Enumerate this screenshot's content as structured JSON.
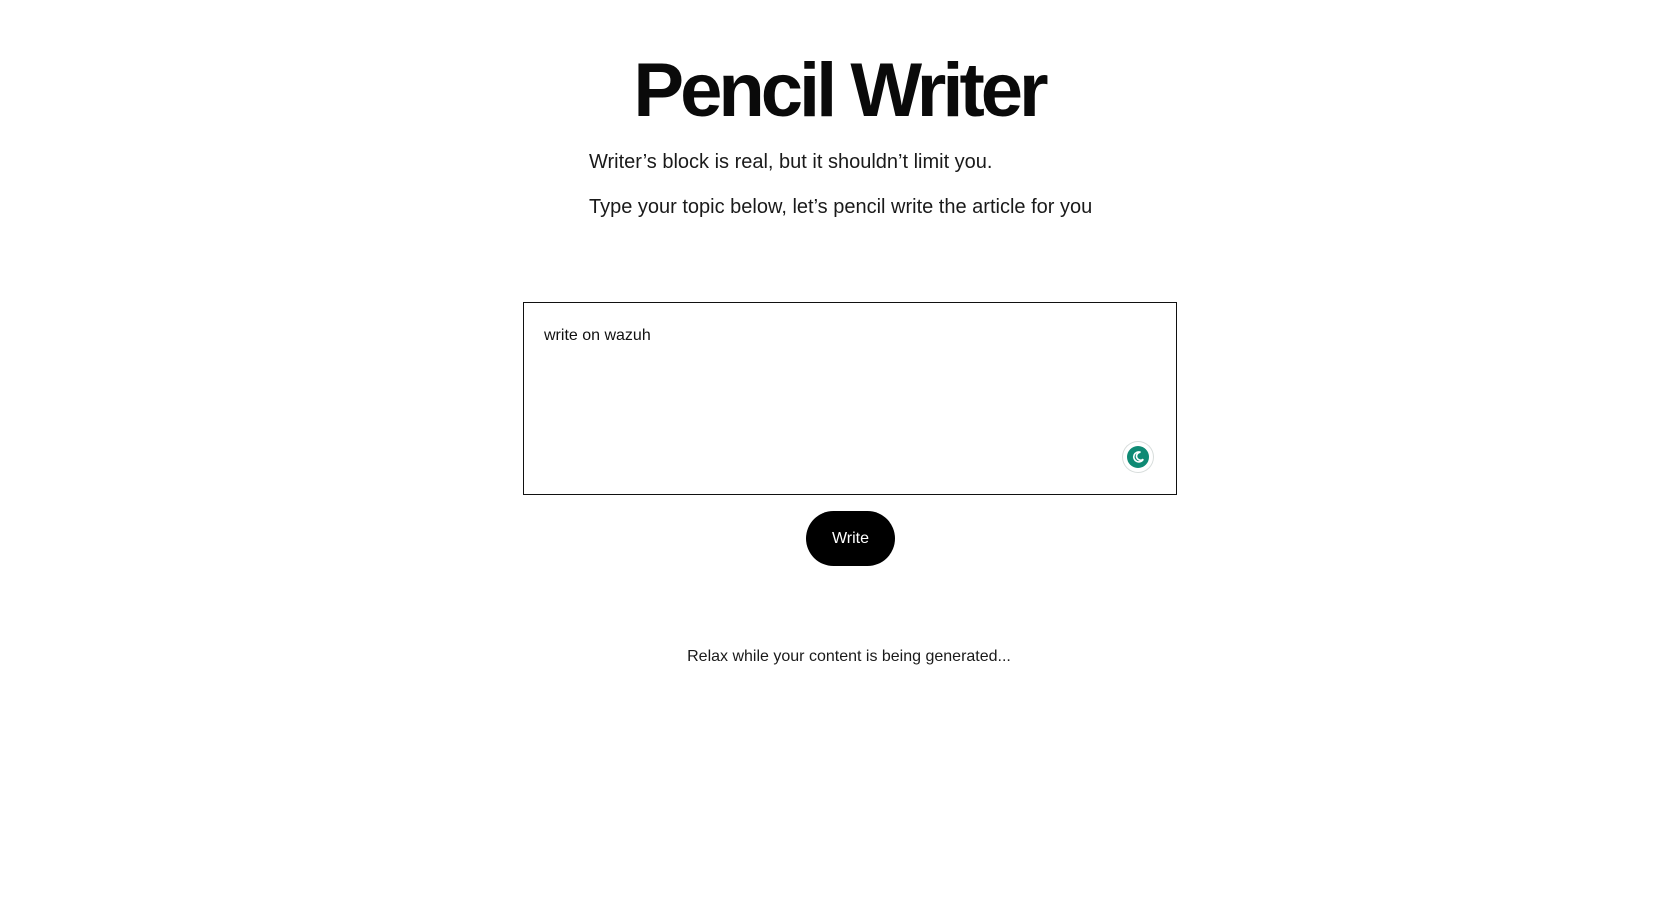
{
  "header": {
    "title": "Pencil Writer",
    "tagline_1": "Writer’s block is real, but it shouldn’t limit you.",
    "tagline_2": "Type your topic below, let’s pencil write the article for you"
  },
  "topic": {
    "value": "write on wazuh",
    "placeholder": ""
  },
  "assistant_badge": {
    "icon": "crescent-icon",
    "color": "#0f8a74"
  },
  "actions": {
    "write_label": "Write"
  },
  "status": {
    "message": "Relax while your content is being generated..."
  }
}
